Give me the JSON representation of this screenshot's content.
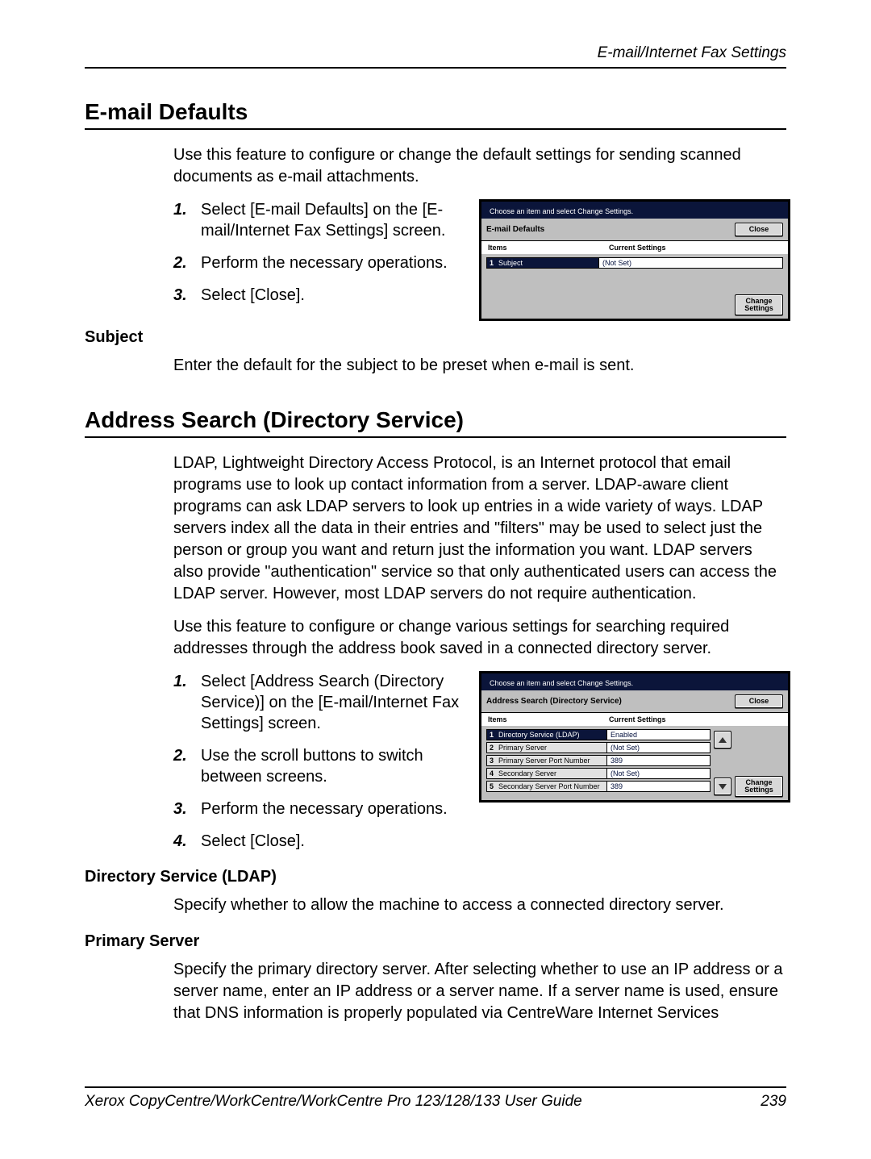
{
  "header": {
    "section": "E-mail/Internet Fax Settings"
  },
  "s1": {
    "heading": "E-mail Defaults",
    "intro": "Use this feature to configure or change the default settings for sending scanned documents as e-mail attachments.",
    "steps": [
      "Select [E-mail Defaults] on the [E-mail/Internet Fax Settings] screen.",
      "Perform the necessary operations.",
      "Select [Close]."
    ],
    "sub": {
      "heading": "Subject",
      "text": "Enter the default for the subject to be preset when e-mail is sent."
    }
  },
  "panel1": {
    "instruction": "Choose an item and select Change Settings.",
    "title": "E-mail Defaults",
    "close": "Close",
    "col_items": "Items",
    "col_settings": "Current Settings",
    "rows": [
      {
        "n": "1",
        "label": "Subject",
        "value": "(Not Set)",
        "selected": true
      }
    ],
    "change": "Change\nSettings"
  },
  "s2": {
    "heading": "Address Search (Directory Service)",
    "para1": "LDAP, Lightweight Directory Access Protocol, is an Internet protocol that email programs use to look up contact information from a server. LDAP-aware client programs can ask LDAP servers to look up entries in a wide variety of ways. LDAP servers index all the data in their entries and \"filters\" may be used to select just the person or group you want and return just the information you want. LDAP servers also provide \"authentication\" service so that only authenticated users can access the LDAP server. However, most LDAP servers do not require authentication.",
    "para2": "Use this feature to configure or change various settings for searching required addresses through the address book saved in a connected directory server.",
    "steps": [
      "Select [Address Search (Directory Service)] on the [E-mail/Internet Fax Settings] screen.",
      "Use the scroll buttons to switch between screens.",
      "Perform the necessary operations.",
      "Select [Close]."
    ],
    "sub1": {
      "heading": "Directory Service (LDAP)",
      "text": "Specify whether to allow the machine to access a connected directory server."
    },
    "sub2": {
      "heading": "Primary Server",
      "text": "Specify the primary directory server. After selecting whether to use an IP address or a server name, enter an IP address or a server name. If a server name is used, ensure that DNS information is properly populated via CentreWare Internet Services"
    }
  },
  "panel2": {
    "instruction": "Choose an item and select Change Settings.",
    "title": "Address Search (Directory Service)",
    "close": "Close",
    "col_items": "Items",
    "col_settings": "Current Settings",
    "rows": [
      {
        "n": "1",
        "label": "Directory Service (LDAP)",
        "value": "Enabled",
        "selected": true
      },
      {
        "n": "2",
        "label": "Primary Server",
        "value": "(Not Set)"
      },
      {
        "n": "3",
        "label": "Primary Server Port Number",
        "value": "389"
      },
      {
        "n": "4",
        "label": "Secondary Server",
        "value": "(Not Set)"
      },
      {
        "n": "5",
        "label": "Secondary Server Port Number",
        "value": "389"
      }
    ],
    "change": "Change\nSettings"
  },
  "footer": {
    "left": "Xerox CopyCentre/WorkCentre/WorkCentre Pro 123/128/133 User Guide",
    "right": "239"
  }
}
